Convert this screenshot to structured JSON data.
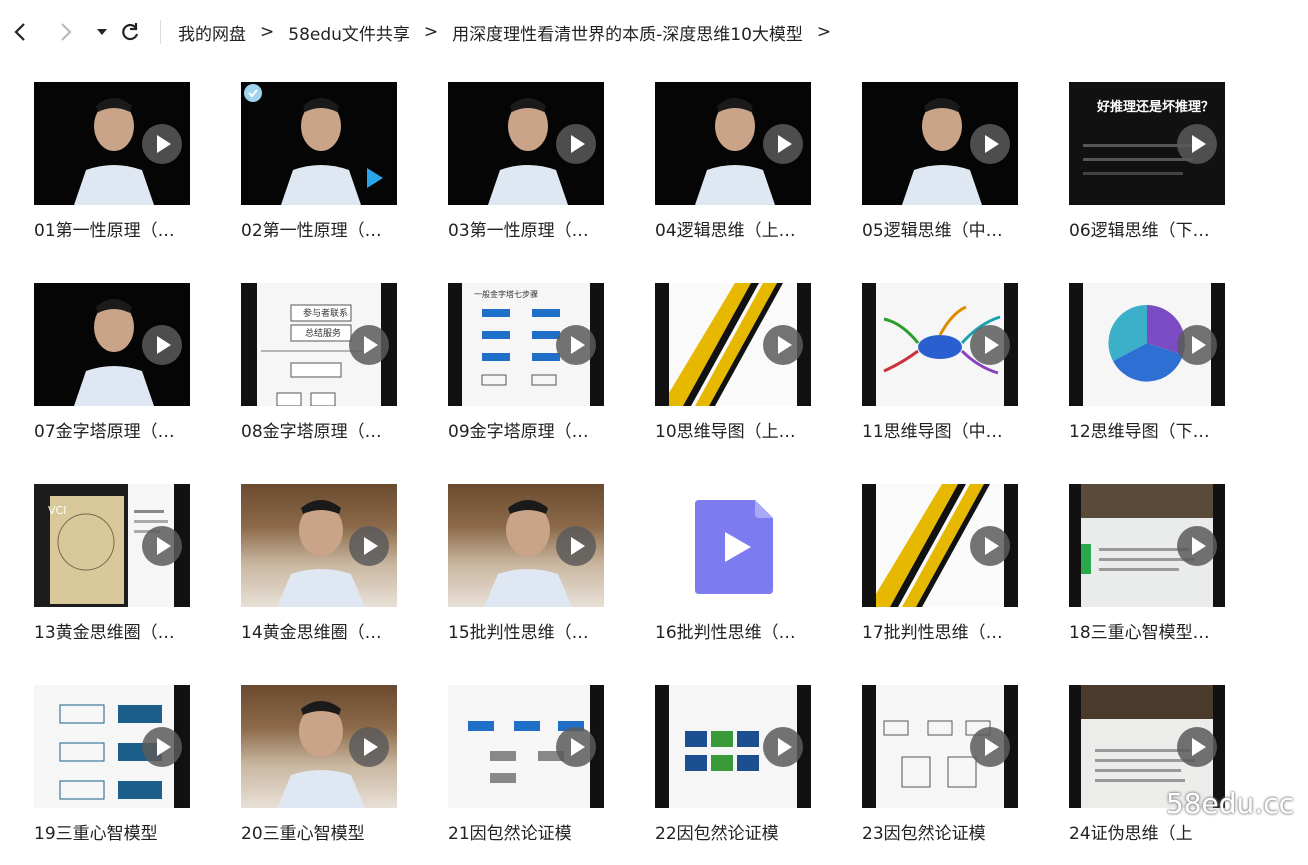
{
  "breadcrumb": {
    "items": [
      "我的网盘",
      "58edu文件共享",
      "用深度理性看清世界的本质-深度思维10大模型"
    ],
    "trailing_sep": ">"
  },
  "files": [
    {
      "name": "01第一性原理（…"
    },
    {
      "name": "02第一性原理（…"
    },
    {
      "name": "03第一性原理（…"
    },
    {
      "name": "04逻辑思维（上…"
    },
    {
      "name": "05逻辑思维（中…"
    },
    {
      "name": "06逻辑思维（下…"
    },
    {
      "name": "07金字塔原理（…"
    },
    {
      "name": "08金字塔原理（…"
    },
    {
      "name": "09金字塔原理（…"
    },
    {
      "name": "10思维导图（上…"
    },
    {
      "name": "11思维导图（中…"
    },
    {
      "name": "12思维导图（下…"
    },
    {
      "name": "13黄金思维圈（…"
    },
    {
      "name": "14黄金思维圈（…"
    },
    {
      "name": "15批判性思维（…"
    },
    {
      "name": "16批判性思维（…"
    },
    {
      "name": "17批判性思维（…"
    },
    {
      "name": "18三重心智模型…"
    },
    {
      "name": "19三重心智模型"
    },
    {
      "name": "20三重心智模型"
    },
    {
      "name": "21因包然论证模"
    },
    {
      "name": "22因包然论证模"
    },
    {
      "name": "23因包然论证模"
    },
    {
      "name": "24证伪思维（上"
    }
  ],
  "thumbnail_text": {
    "t06_title": "好推理还是坏推理？",
    "t08_box1": "参与者联系",
    "t08_box2": "总结服务",
    "t09_title": "一般金字塔七步骤",
    "t13_title": "VCI"
  },
  "watermark": "58edu.cc"
}
